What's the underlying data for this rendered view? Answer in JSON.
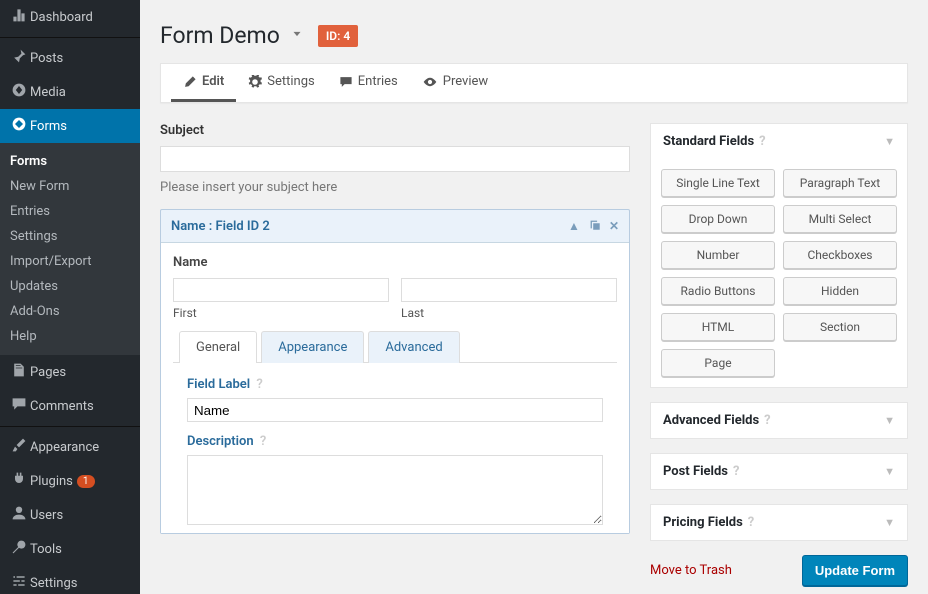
{
  "sidebar": {
    "items": [
      {
        "icon": "dashboard",
        "label": "Dashboard"
      },
      {
        "icon": "pin",
        "label": "Posts"
      },
      {
        "icon": "media",
        "label": "Media"
      },
      {
        "icon": "forms",
        "label": "Forms"
      },
      {
        "icon": "page",
        "label": "Pages"
      },
      {
        "icon": "comment",
        "label": "Comments"
      },
      {
        "icon": "brush",
        "label": "Appearance"
      },
      {
        "icon": "plug",
        "label": "Plugins",
        "badge": "1"
      },
      {
        "icon": "user",
        "label": "Users"
      },
      {
        "icon": "wrench",
        "label": "Tools"
      },
      {
        "icon": "sliders",
        "label": "Settings"
      }
    ],
    "sub": [
      "Forms",
      "New Form",
      "Entries",
      "Settings",
      "Import/Export",
      "Updates",
      "Add-Ons",
      "Help"
    ]
  },
  "header": {
    "title": "Form Demo",
    "id_badge": "ID: 4"
  },
  "tabs": [
    "Edit",
    "Settings",
    "Entries",
    "Preview"
  ],
  "subject": {
    "label": "Subject",
    "hint": "Please insert your subject here"
  },
  "fieldbox": {
    "head": "Name : Field ID 2",
    "body_label": "Name",
    "first": "First",
    "last": "Last"
  },
  "innertabs": [
    "General",
    "Appearance",
    "Advanced"
  ],
  "field_settings": {
    "field_label": "Field Label",
    "field_label_value": "Name",
    "description": "Description"
  },
  "panels": {
    "standard": {
      "title": "Standard Fields",
      "items": [
        "Single Line Text",
        "Paragraph Text",
        "Drop Down",
        "Multi Select",
        "Number",
        "Checkboxes",
        "Radio Buttons",
        "Hidden",
        "HTML",
        "Section",
        "Page"
      ]
    },
    "advanced": {
      "title": "Advanced Fields"
    },
    "post": {
      "title": "Post Fields"
    },
    "pricing": {
      "title": "Pricing Fields"
    }
  },
  "footer": {
    "trash": "Move to Trash",
    "update": "Update Form"
  }
}
